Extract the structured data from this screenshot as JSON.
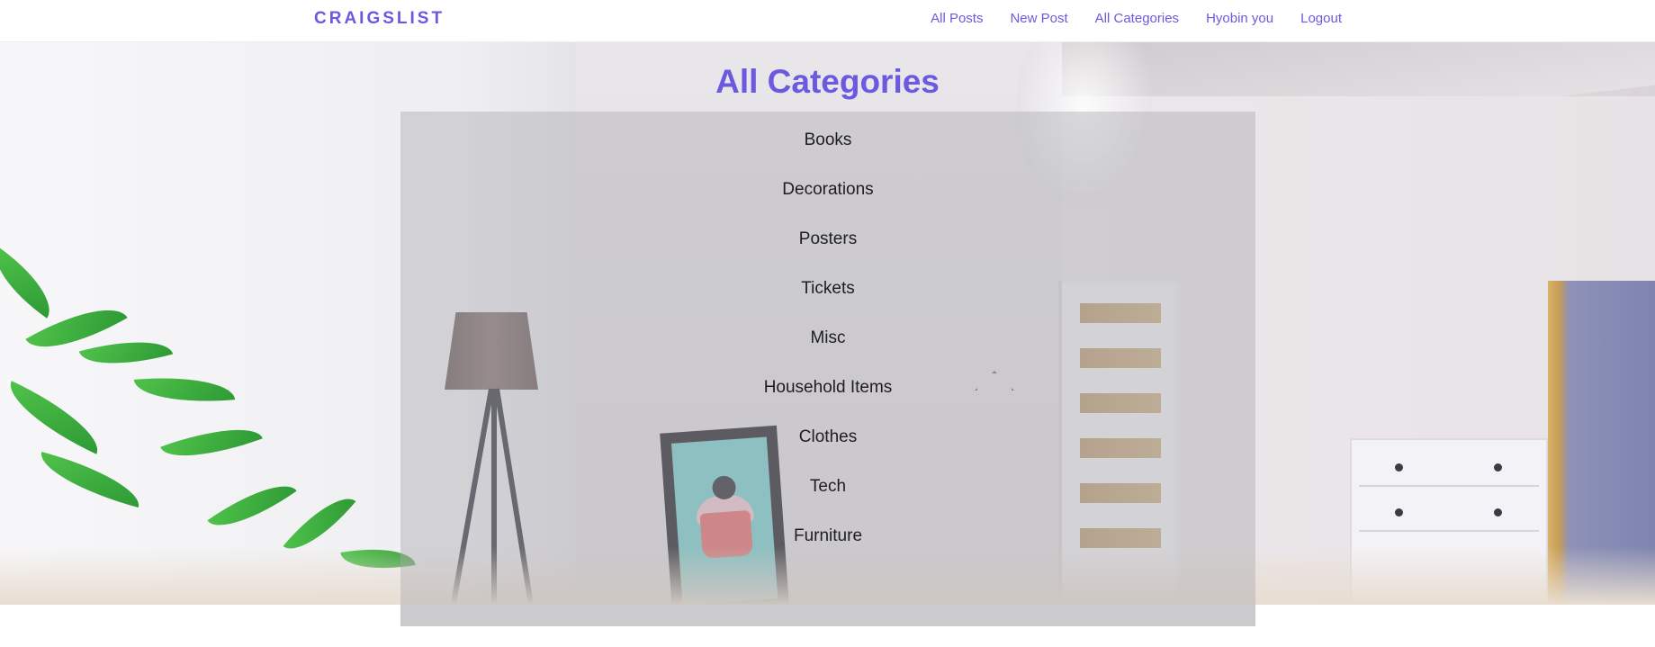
{
  "navbar": {
    "brand": "CRAIGSLIST",
    "links": [
      {
        "label": "All Posts"
      },
      {
        "label": "New Post"
      },
      {
        "label": "All Categories"
      },
      {
        "label": "Hyobin you"
      },
      {
        "label": "Logout"
      }
    ]
  },
  "main": {
    "title": "All Categories",
    "categories": [
      {
        "label": "Books"
      },
      {
        "label": "Decorations"
      },
      {
        "label": "Posters"
      },
      {
        "label": "Tickets"
      },
      {
        "label": "Misc"
      },
      {
        "label": "Household Items"
      },
      {
        "label": "Clothes"
      },
      {
        "label": "Tech"
      },
      {
        "label": "Furniture"
      }
    ]
  },
  "colors": {
    "accent": "#6a5ae0",
    "text": "#1d1d22",
    "panel_overlay": "rgba(170,170,174,0.42)"
  }
}
